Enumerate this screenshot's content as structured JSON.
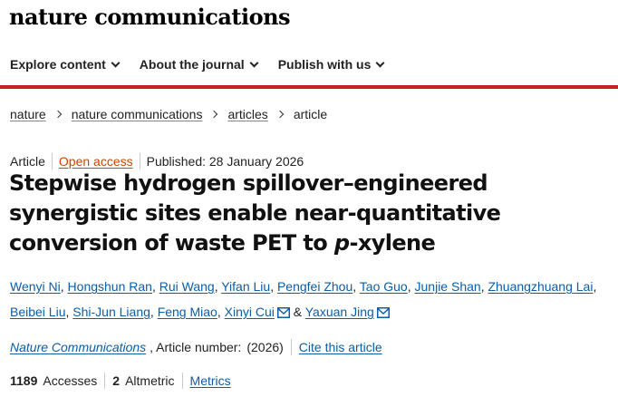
{
  "header": {
    "brand": "nature communications"
  },
  "nav": {
    "items": [
      {
        "label": "Explore content"
      },
      {
        "label": "About the journal"
      },
      {
        "label": "Publish with us"
      }
    ]
  },
  "breadcrumb": [
    "nature",
    "nature communications",
    "articles",
    "article"
  ],
  "article": {
    "type": "Article",
    "access": "Open access",
    "published": "Published: 28 January 2026",
    "title_part1": "Stepwise hydrogen spillover–engineered synergistic sites enable near-quantitative conversion of waste PET to ",
    "title_italic": "p",
    "title_part2": "-xylene",
    "authors": [
      "Wenyi Ni",
      "Hongshun Ran",
      "Rui Wang",
      "Yifan Liu",
      "Pengfei Zhou",
      "Tao Guo",
      "Junjie Shan",
      "Zhuangzhuang Lai",
      "Beibei Liu",
      "Shi-Jun Liang",
      "Feng Miao",
      "Xinyi Cui",
      "Yaxuan Jing"
    ],
    "author_conjunction": "&",
    "journal": "Nature Communications",
    "article_number_text": ", Article number:",
    "year": "(2026)",
    "cite_label": "Cite this article"
  },
  "metrics": {
    "accesses_value": "1189",
    "accesses_label": "Accesses",
    "altmetric_value": "2",
    "altmetric_label": "Altmetric",
    "metrics_link": "Metrics"
  },
  "colors": {
    "accent_red": "#c51f1f",
    "link_blue": "#0b5ea8",
    "open_access_orange": "#c74700"
  },
  "icons": [
    "chevron-down-icon",
    "chevron-right-icon",
    "mail-icon"
  ]
}
